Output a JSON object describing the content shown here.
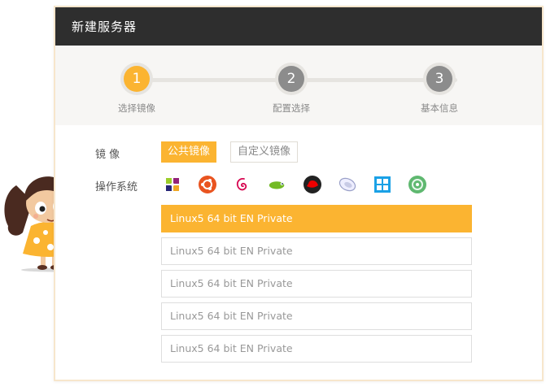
{
  "dialog": {
    "title": "新建服务器"
  },
  "steps": [
    {
      "number": "1",
      "label": "选择镜像",
      "active": true
    },
    {
      "number": "2",
      "label": "配置选择",
      "active": false
    },
    {
      "number": "3",
      "label": "基本信息",
      "active": false
    }
  ],
  "image_row": {
    "label": "镜 像",
    "options": [
      "公共镜像",
      "自定义镜像"
    ],
    "selected": "公共镜像"
  },
  "os_row": {
    "label": "操作系统",
    "icons": [
      "centos-icon",
      "ubuntu-icon",
      "debian-icon",
      "opensuse-icon",
      "redhat-icon",
      "fedora-icon",
      "windows-icon",
      "gentoo-icon"
    ]
  },
  "images": [
    {
      "name": "Linux5 64 bit EN Private",
      "selected": true
    },
    {
      "name": "Linux5 64 bit EN Private",
      "selected": false
    },
    {
      "name": "Linux5 64 bit EN Private",
      "selected": false
    },
    {
      "name": "Linux5 64 bit EN Private",
      "selected": false
    },
    {
      "name": "Linux5 64 bit EN Private",
      "selected": false
    }
  ],
  "colors": {
    "accent": "#fbb431",
    "header_bg": "#2e2e2e",
    "step_inactive": "#8c8c8c"
  }
}
